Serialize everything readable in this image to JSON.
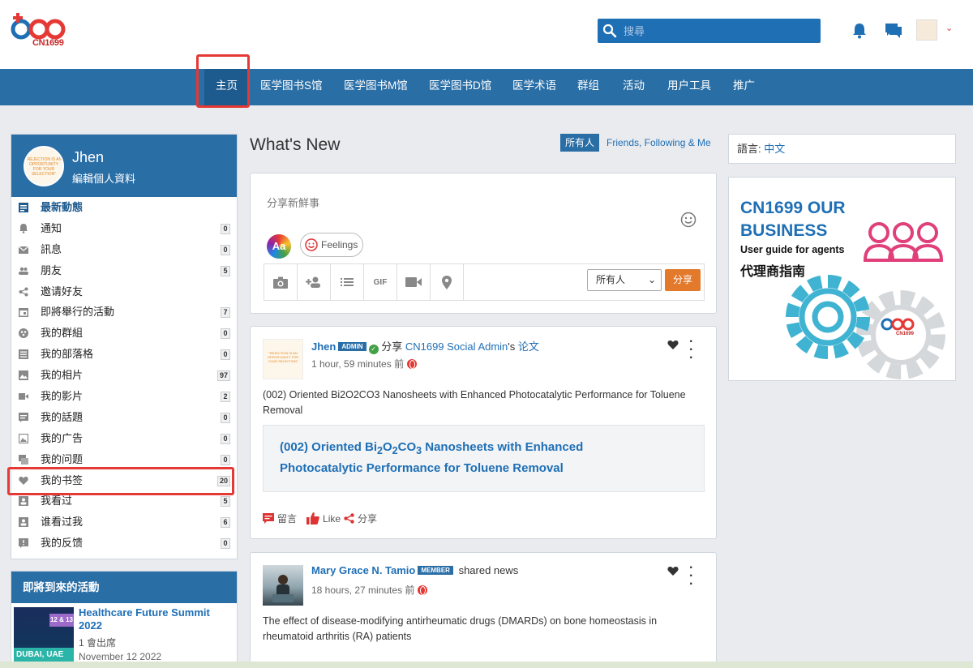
{
  "header": {
    "logo_text": "CN1699",
    "search_placeholder": "搜尋"
  },
  "nav": {
    "items": [
      "主页",
      "医学图书S馆",
      "医学图书M馆",
      "医学图书D馆",
      "医学术语",
      "群组",
      "活动",
      "用户工具",
      "推广"
    ],
    "active_index": 0
  },
  "profile": {
    "name": "Jhen",
    "edit_label": "編輯個人資料",
    "avatar_text": "\"REJECTION IS AN OPPORTUNITY FOR YOUR SELECTION\""
  },
  "menu": [
    {
      "label": "最新動態",
      "icon": "newsfeed-icon",
      "badge": ""
    },
    {
      "label": "通知",
      "icon": "bell-icon",
      "badge": "0"
    },
    {
      "label": "訊息",
      "icon": "mail-icon",
      "badge": "0"
    },
    {
      "label": "朋友",
      "icon": "friends-icon",
      "badge": "5"
    },
    {
      "label": "邀请好友",
      "icon": "share-icon",
      "badge": ""
    },
    {
      "label": "即將舉行的活動",
      "icon": "calendar-icon",
      "badge": "7"
    },
    {
      "label": "我的群組",
      "icon": "group-icon",
      "badge": "0"
    },
    {
      "label": "我的部落格",
      "icon": "blog-icon",
      "badge": "0"
    },
    {
      "label": "我的相片",
      "icon": "photo-icon",
      "badge": "97"
    },
    {
      "label": "我的影片",
      "icon": "video-icon",
      "badge": "2"
    },
    {
      "label": "我的話題",
      "icon": "topic-icon",
      "badge": "0"
    },
    {
      "label": "我的广告",
      "icon": "ad-icon",
      "badge": "0"
    },
    {
      "label": "我的问题",
      "icon": "question-icon",
      "badge": "0"
    },
    {
      "label": "我的书签",
      "icon": "heart-icon",
      "badge": "20"
    },
    {
      "label": "我看过",
      "icon": "profile-view-icon",
      "badge": "5"
    },
    {
      "label": "谁看过我",
      "icon": "viewer-icon",
      "badge": "6"
    },
    {
      "label": "我的反馈",
      "icon": "feedback-icon",
      "badge": "0"
    }
  ],
  "events": {
    "title": "即將到來的活動",
    "name": "Healthcare Future Summit 2022",
    "attend": "1 會出席",
    "date": "November 12 2022",
    "thumb_days": "12 & 13",
    "thumb_place": "DUBAI, UAE"
  },
  "whats_new": {
    "title": "What's New",
    "filter_all": "所有人",
    "filter_friends": "Friends, Following & Me"
  },
  "composer": {
    "placeholder": "分享新鮮事",
    "aa_label": "Aa",
    "feelings_label": "Feelings",
    "gif_label": "GIF",
    "privacy": "所有人",
    "share_label": "分享"
  },
  "posts": [
    {
      "author": "Jhen",
      "role": "ADMIN",
      "action": "分享",
      "target_user": "CN1699 Social Admin",
      "possessive": "'s",
      "target_type": "论文",
      "time": "1 hour, 59 minutes 前",
      "text": "(002) Oriented Bi2O2CO3 Nanosheets with Enhanced Photocatalytic Performance for Toluene Removal",
      "preview_title_a": "(002) Oriented Bi",
      "preview_sub1": "2",
      "preview_mid1": "O",
      "preview_sub2": "2",
      "preview_mid2": "CO",
      "preview_sub3": "3",
      "preview_title_b": " Nanosheets with Enhanced Photocatalytic Performance for Toluene Removal",
      "comment_label": "留言",
      "like_label": "Like",
      "share_label": "分享"
    },
    {
      "author": "Mary Grace N. Tamio",
      "role": "MEMBER",
      "action": "shared news",
      "time": "18 hours, 27 minutes 前",
      "text": "The effect of disease-modifying antirheumatic drugs (DMARDs) on bone homeostasis in rheumatoid arthritis (RA) patients"
    }
  ],
  "language": {
    "label": "語言:",
    "value": "中文"
  },
  "ad": {
    "line1": "CN1699 OUR",
    "line2": "BUSINESS",
    "line3": "User guide for agents",
    "line4": "代理商指南",
    "logo_text": "CN1699"
  },
  "colors": {
    "brand_blue": "#2a6ea6",
    "link_blue": "#1f6fb5",
    "highlight_red": "#e53935",
    "share_orange": "#e2792b"
  }
}
